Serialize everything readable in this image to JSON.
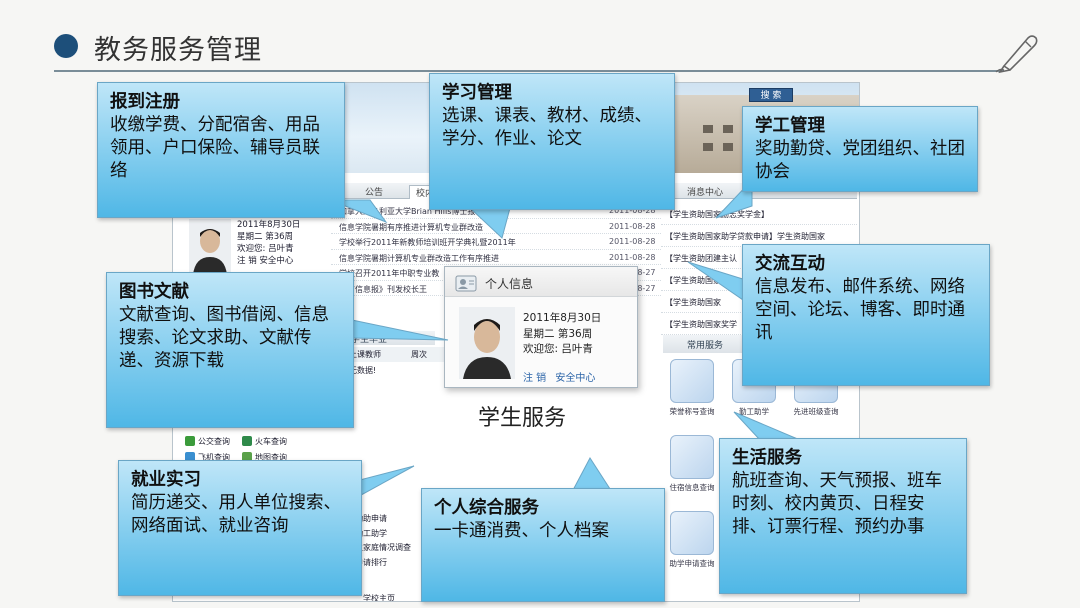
{
  "header": {
    "title": "教务服务管理"
  },
  "colors": {
    "header_dot": "#1d4f7a",
    "callout_top": "#bfe6f8",
    "callout_bottom": "#4fb7e6"
  },
  "portal": {
    "search_label": "搜 索",
    "tabs": [
      "公告",
      "校内",
      "消息中心"
    ],
    "news": [
      {
        "title": "加拿大维多利亚大学Brian Hills博士报告会",
        "date": "2011-08-28"
      },
      {
        "title": "信息学院暑期有序推进计算机专业群改造",
        "date": "2011-08-28"
      },
      {
        "title": "学校举行2011年新教师培训班开学典礼暨2011年",
        "date": "2011-08-28"
      },
      {
        "title": "信息学院暑期计算机专业群改造工作有序推进",
        "date": "2011-08-28"
      },
      {
        "title": "学校召开2011年中职专业教",
        "date": "2011-08-27"
      },
      {
        "title": "教育信息报》刊发校长王",
        "date": "2011-08-27"
      }
    ],
    "messages": [
      "【学生资助国家励志奖学金】",
      "【学生资助国家助学贷款申请】学生资助国家",
      "【学生资助团建主认",
      "【学生资助国家",
      "【学生资助国家",
      "【学生资助国家奖学"
    ],
    "small_profile": {
      "date": "2011年8月30日",
      "week": "星期二 第36周",
      "welcome": "欢迎您: 吕叶青",
      "actions": "注 销  安全中心"
    },
    "grad_title": "学生毕业",
    "grad_cols": [
      "上课教师",
      "周次"
    ],
    "grad_empty": "无数据!",
    "quick_links": [
      {
        "label": "公交查询",
        "color": "#3b9b3b"
      },
      {
        "label": "火车查询",
        "color": "#2f8a4a"
      },
      {
        "label": "飞机查询",
        "color": "#3a8fd0"
      },
      {
        "label": "地图查询",
        "color": "#5aa14a"
      }
    ],
    "common_services_title": "常用服务",
    "services": [
      "荣誉称号查询",
      "勤工助学",
      "先进班级查询",
      "住宿信息查询",
      "助学申请查询"
    ],
    "left_lower": [
      "勤助申请",
      "勤工助学",
      "生家庭情况调查",
      "申请排行"
    ],
    "home_link": "学校主页"
  },
  "info_card": {
    "title": "个人信息",
    "date": "2011年8月30日",
    "week": "星期二  第36周",
    "welcome": "欢迎您: 吕叶青",
    "logout": "注 销",
    "security": "安全中心"
  },
  "service_caption": "学生服务",
  "callouts": [
    {
      "id": "register",
      "title": "报到注册",
      "body": "收缴学费、分配宿舍、用品领用、户口保险、辅导员联络"
    },
    {
      "id": "study",
      "title": "学习管理",
      "body": "选课、课表、教材、成绩、学分、作业、论文"
    },
    {
      "id": "student-affairs",
      "title": "学工管理",
      "body": "奖助勤贷、党团组织、社团协会"
    },
    {
      "id": "library",
      "title": "图书文献",
      "body": "文献查询、图书借阅、信息搜索、论文求助、文献传递、资源下载"
    },
    {
      "id": "communication",
      "title": "交流互动",
      "body": "信息发布、邮件系统、网络空间、论坛、博客、即时通讯"
    },
    {
      "id": "employment",
      "title": "就业实习",
      "body": "简历递交、用人单位搜索、网络面试、就业咨询"
    },
    {
      "id": "personal",
      "title": "个人综合服务",
      "body": "一卡通消费、个人档案"
    },
    {
      "id": "life",
      "title": "生活服务",
      "body": "航班查询、天气预报、班车时刻、校内黄页、日程安排、订票行程、预约办事"
    }
  ]
}
